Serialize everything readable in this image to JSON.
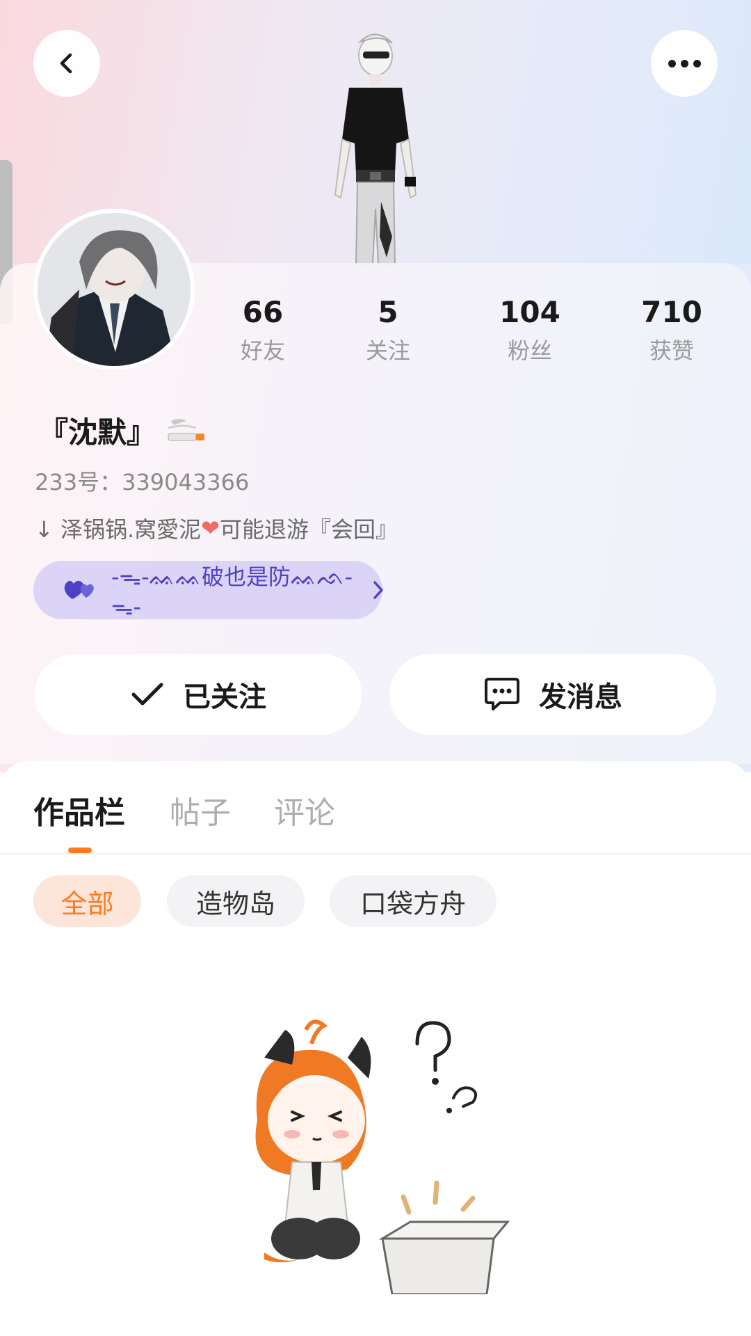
{
  "header": {
    "back_icon": "chevron-left-icon",
    "more_icon": "more-horizontal-icon"
  },
  "profile": {
    "stats": [
      {
        "value": "66",
        "label": "好友"
      },
      {
        "value": "5",
        "label": "关注"
      },
      {
        "value": "104",
        "label": "粉丝"
      },
      {
        "value": "710",
        "label": "获赞"
      }
    ],
    "nickname": "『沈默』",
    "id_line": "233号：339043366",
    "bio_prefix": "↓ 泽锅锅.窝愛泥",
    "bio_suffix": "可能退游『会回』",
    "tag_text": "-ᯓ-ᨐᨐ破也是防ᨐᨒ-ᯓ-"
  },
  "actions": {
    "follow_label": "已关注",
    "message_label": "发消息"
  },
  "tabs": [
    {
      "label": "作品栏",
      "active": true
    },
    {
      "label": "帖子",
      "active": false
    },
    {
      "label": "评论",
      "active": false
    }
  ],
  "filters": [
    {
      "label": "全部",
      "selected": true
    },
    {
      "label": "造物岛",
      "selected": false
    },
    {
      "label": "口袋方舟",
      "selected": false
    }
  ],
  "colors": {
    "accent": "#ff7a1f",
    "tag_bg": "#dcd4f6",
    "tag_text": "#4d42c6"
  }
}
